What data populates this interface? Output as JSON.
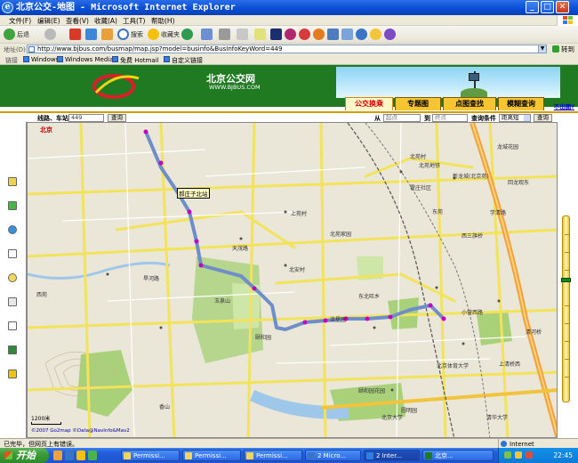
{
  "window": {
    "title": "北京公交-地图 - Microsoft Internet Explorer",
    "minimize": "_",
    "maximize": "□",
    "close": "✕"
  },
  "menu": {
    "items": [
      "文件(F)",
      "编辑(E)",
      "查看(V)",
      "收藏(A)",
      "工具(T)",
      "帮助(H)"
    ]
  },
  "toolbar": {
    "back": "后退",
    "search": "搜索",
    "favorites": "收藏夹"
  },
  "address": {
    "label": "地址(D)",
    "url": "http://www.bjbus.com/busmap/map.jsp?model=businfo&BusInfoKeyWord=449",
    "go": "转到"
  },
  "links": {
    "label": "链接",
    "items": [
      "Windows",
      "Windows Media",
      "免费 Hotmail",
      "自定义链接"
    ]
  },
  "header": {
    "site_title": "北京公交网",
    "site_url": "WWW.BJBUS.COM",
    "tabs": [
      "公交换乘",
      "专题图",
      "点图查找",
      "模糊查询"
    ],
    "active_tab": 0,
    "notice": "不出图?"
  },
  "search": {
    "route_label": "线路、车站查询",
    "route_value": "449",
    "route_button": "查询",
    "from_label": "从",
    "from_placeholder": "起点",
    "to_label": "到",
    "to_placeholder": "终点",
    "condition_label": "查询条件",
    "condition_value": "距离短",
    "submit_button": "查询"
  },
  "map": {
    "city_tag": "北京",
    "tooltip": "郝庄子北站",
    "scale": "1200米",
    "copyright": "©2007 Go2map ©Data@NavInfo&Mav2",
    "labels": [
      "北京西站",
      "北苑村",
      "龙城花园",
      "北苑地铁",
      "新龙城(北京苑)",
      "回龙观东",
      "霍庄社区",
      "东苑",
      "上苑村",
      "北苑家园",
      "清河",
      "西三旗桥",
      "北安村",
      "东北旺乡",
      "小营西路",
      "清河桥",
      "北京体育大学",
      "上清桥西",
      "颐和园",
      "玉泉山",
      "香山",
      "圆明园",
      "颐和园花园",
      "北京大学",
      "清华大学",
      "学清路",
      "流星园",
      "旱河路",
      "天茂路",
      "西苑"
    ]
  },
  "statusbar": {
    "text": "已完毕，但网页上有错误。",
    "zone": "Internet"
  },
  "taskbar": {
    "start": "开始",
    "tasks": [
      "Permissi...",
      "Permissi...",
      "Permissi...",
      "2 Micro...",
      "2 Inter...",
      "北京..."
    ],
    "clock": "22:45"
  },
  "colors": {
    "banner_green": "#1f7a22",
    "tab_yellow": "#f7c532",
    "route_blue": "#6f8ec8",
    "stop_magenta": "#c000c0",
    "road_yellow": "#f2e35a",
    "highway_orange": "#f2a23c"
  }
}
